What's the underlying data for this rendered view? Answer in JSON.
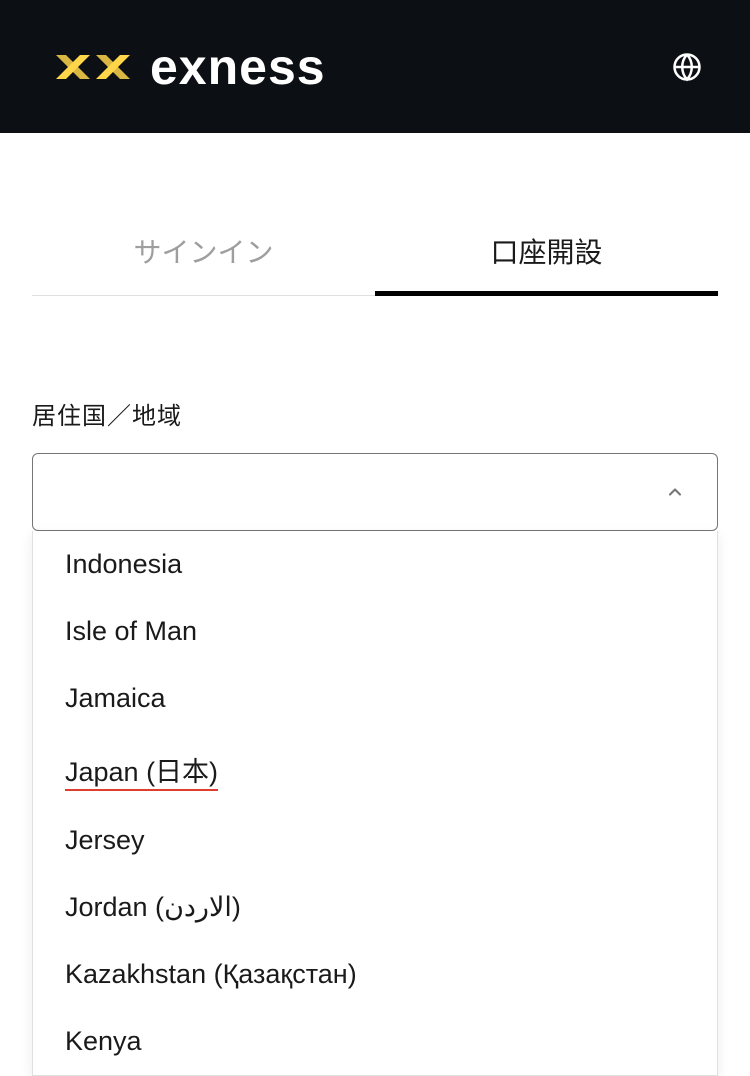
{
  "header": {
    "brand_name": "exness"
  },
  "tabs": {
    "signin": "サインイン",
    "register": "口座開設"
  },
  "form": {
    "country_label": "居住国／地域",
    "country_value": ""
  },
  "dropdown": {
    "items": [
      {
        "label": "Indonesia",
        "highlighted": false
      },
      {
        "label": "Isle of Man",
        "highlighted": false
      },
      {
        "label": "Jamaica",
        "highlighted": false
      },
      {
        "label": "Japan (日本)",
        "highlighted": true
      },
      {
        "label": "Jersey",
        "highlighted": false
      },
      {
        "label": "Jordan (الاردن)",
        "highlighted": false
      },
      {
        "label": "Kazakhstan (Қазақстан)",
        "highlighted": false
      },
      {
        "label": "Kenya",
        "highlighted": false
      }
    ]
  }
}
